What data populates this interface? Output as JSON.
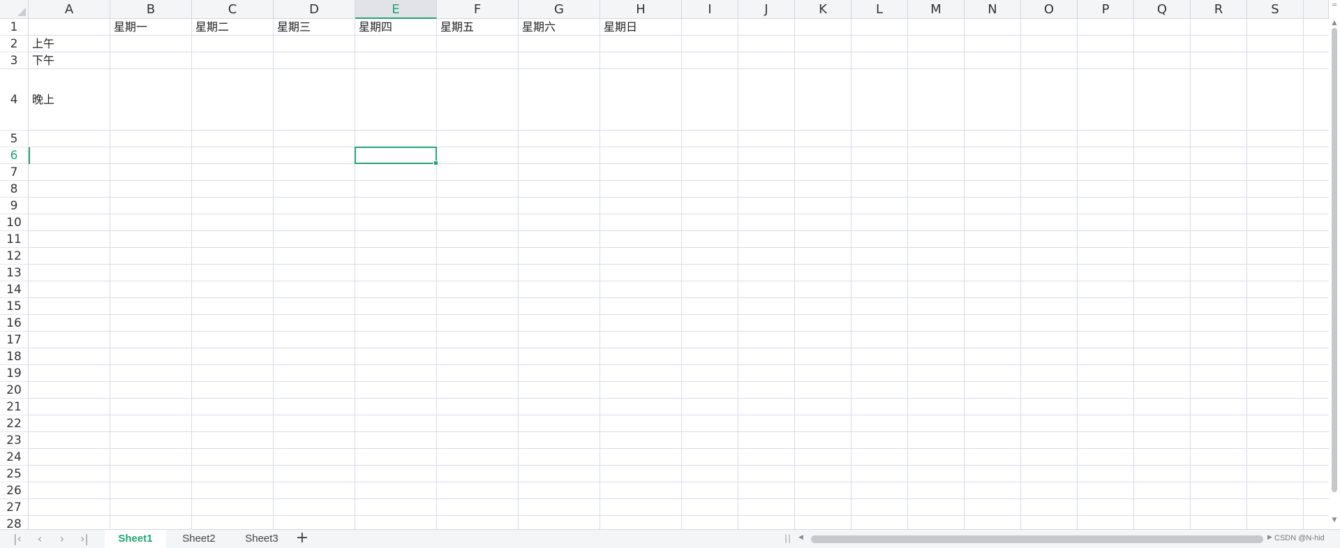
{
  "spreadsheet": {
    "columns": [
      "A",
      "B",
      "C",
      "D",
      "E",
      "F",
      "G",
      "H",
      "I",
      "J",
      "K",
      "L",
      "M",
      "N",
      "O",
      "P",
      "Q",
      "R",
      "S"
    ],
    "rows": [
      "1",
      "2",
      "3",
      "4",
      "5",
      "6",
      "7",
      "8",
      "9",
      "10",
      "11",
      "12",
      "13",
      "14",
      "15",
      "16",
      "17",
      "18",
      "19",
      "20",
      "21",
      "22",
      "23",
      "24",
      "25",
      "26",
      "27",
      "28"
    ],
    "active_cell": {
      "column": "E",
      "row": "6"
    },
    "cells": {
      "B1": "星期一",
      "C1": "星期二",
      "D1": "星期三",
      "E1": "星期四",
      "F1": "星期五",
      "G1": "星期六",
      "H1": "星期日",
      "A2": "上午",
      "A3": "下午",
      "A4": "晚上"
    }
  },
  "sheets": {
    "tabs": [
      {
        "label": "Sheet1",
        "active": true
      },
      {
        "label": "Sheet2",
        "active": false
      },
      {
        "label": "Sheet3",
        "active": false
      }
    ],
    "add_icon": "plus-icon"
  },
  "navigation": {
    "icons": [
      "first-sheet-icon",
      "prev-sheet-icon",
      "next-sheet-icon",
      "last-sheet-icon"
    ]
  },
  "watermark": "CSDN @N-hid",
  "colors": {
    "accent": "#1ea672",
    "gridline": "#d8dcea",
    "header_bg": "#f4f5f7"
  }
}
